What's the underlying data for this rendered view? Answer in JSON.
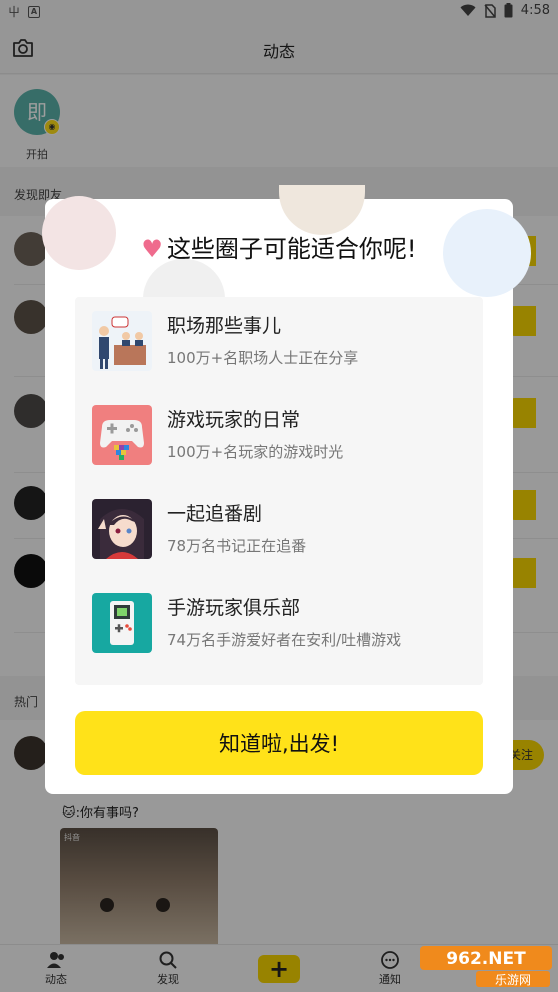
{
  "status_bar": {
    "time": "4:58",
    "left_icon_1": "屮",
    "left_icon_2": "A"
  },
  "header": {
    "title": "动态"
  },
  "story": {
    "avatar_text": "即",
    "label": "开拍"
  },
  "sections": {
    "discover_label": "发现即友",
    "hot_label": "热门"
  },
  "feed": {
    "hot_post": {
      "follow_label": "关注",
      "chat_line_2": "你有事吗?",
      "chat_prefix_emoji": "🐱",
      "video_brand": "抖音"
    }
  },
  "tabbar": {
    "tabs": [
      {
        "label": "动态",
        "icon": "people-icon"
      },
      {
        "label": "发现",
        "icon": "search-icon"
      },
      {
        "label": "+",
        "icon": "plus-icon"
      },
      {
        "label": "通知",
        "icon": "chat-bubble-icon"
      }
    ]
  },
  "dialog": {
    "title": "这些圈子可能适合你呢!",
    "items": [
      {
        "name": "职场那些事儿",
        "desc": "100万+名职场人士正在分享",
        "icon": "meeting-icon"
      },
      {
        "name": "游戏玩家的日常",
        "desc": "100万+名玩家的游戏时光",
        "icon": "gamepad-icon"
      },
      {
        "name": "一起追番剧",
        "desc": "78万名书记正在追番",
        "icon": "anime-girl-icon"
      },
      {
        "name": "手游玩家俱乐部",
        "desc": "74万名手游爱好者在安利/吐槽游戏",
        "icon": "gameboy-icon"
      }
    ],
    "button_label": "知道啦,出发!"
  },
  "watermark": {
    "text_main": "962.NET",
    "text_sub": "乐游网"
  },
  "colors": {
    "accent_yellow": "#ffe219",
    "heart_pink": "#ef6b8d",
    "teal": "#5ab1a8"
  }
}
